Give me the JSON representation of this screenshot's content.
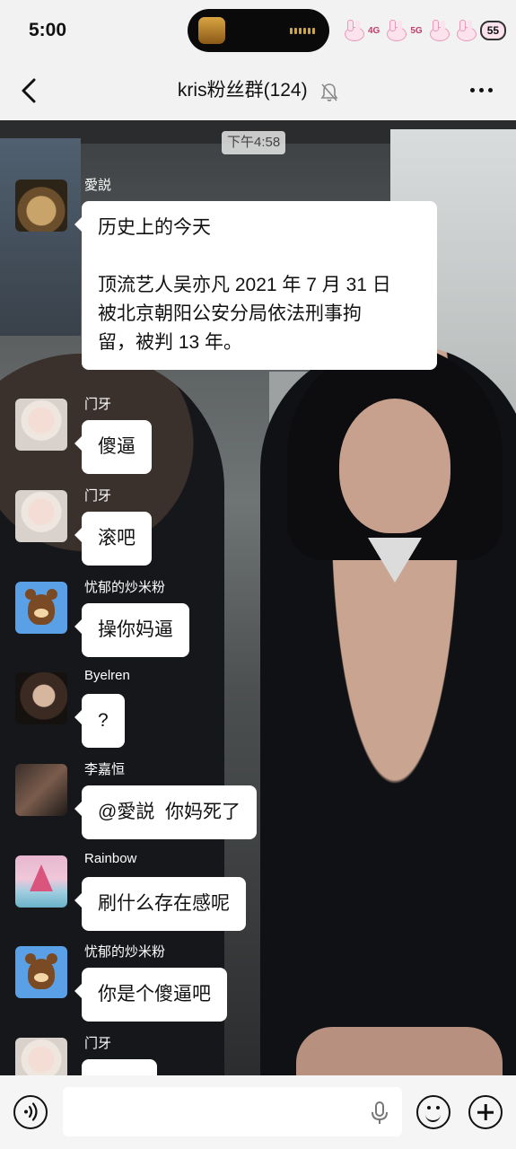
{
  "status_bar": {
    "time": "5:00",
    "network_1": "4G",
    "network_2": "5G",
    "battery": "55"
  },
  "header": {
    "title": "kris粉丝群(124)"
  },
  "timestamp": "下午4:58",
  "messages": [
    {
      "sender": "愛説",
      "avatar": "cat-avatar",
      "lines": [
        "历史上的今天",
        "",
        "顶流艺人吴亦凡 2021 年 7 月 31 日",
        "被北京朝阳公安分局依法刑事拘",
        "留，被判 13 年。"
      ]
    },
    {
      "sender": "门牙",
      "avatar": "girl-avatar",
      "lines": [
        "傻逼"
      ]
    },
    {
      "sender": "门牙",
      "avatar": "girl-avatar",
      "lines": [
        "滚吧"
      ]
    },
    {
      "sender": "忧郁的炒米粉",
      "avatar": "bear-avatar",
      "lines": [
        "操你妈逼"
      ]
    },
    {
      "sender": "Byelren",
      "avatar": "guy-avatar",
      "lines": [
        "?"
      ]
    },
    {
      "sender": "李嘉恒",
      "avatar": "shoe-avatar",
      "lines": [
        "@愛説  你妈死了"
      ]
    },
    {
      "sender": "Rainbow",
      "avatar": "ship-avatar",
      "lines": [
        "刷什么存在感呢"
      ]
    },
    {
      "sender": "忧郁的炒米粉",
      "avatar": "bear-avatar",
      "lines": [
        "你是个傻逼吧"
      ]
    },
    {
      "sender": "门牙",
      "avatar": "girl-avatar",
      "lines": [
        ""
      ]
    }
  ],
  "input_bar": {
    "placeholder": ""
  },
  "icons": {
    "back": "chevron-left-icon",
    "mute": "bell-off-icon",
    "more": "more-dots-icon",
    "voice": "voice-icon",
    "mic": "microphone-icon",
    "emoji": "emoji-icon",
    "plus": "plus-icon"
  },
  "colors": {
    "bubble": "#ffffff",
    "sender_text": "#ffffff",
    "bar_background": "#f2f2f2"
  }
}
